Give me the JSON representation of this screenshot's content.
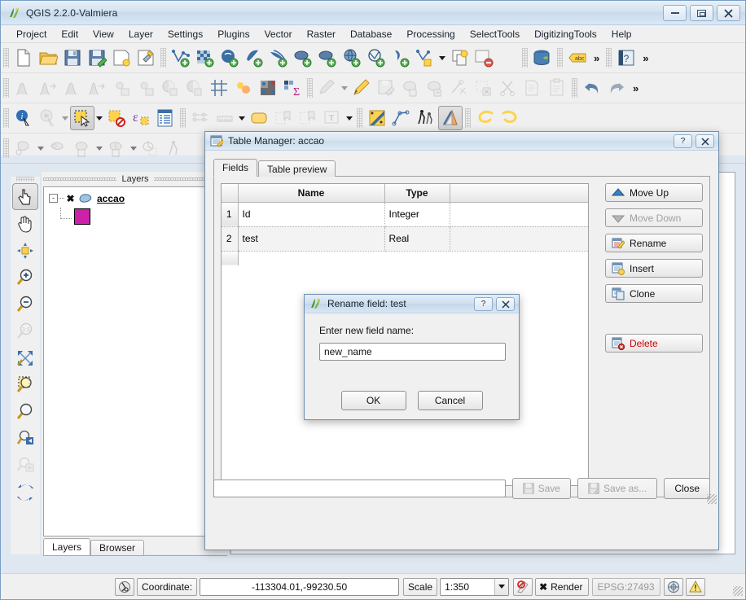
{
  "window": {
    "title": "QGIS 2.2.0-Valmiera",
    "icon": "qgis-logo-icon",
    "minimize": "minimize-icon",
    "maximize": "maximize-icon",
    "close": "close-icon"
  },
  "menu": {
    "items": [
      "Project",
      "Edit",
      "View",
      "Layer",
      "Settings",
      "Plugins",
      "Vector",
      "Raster",
      "Database",
      "Processing",
      "SelectTools",
      "DigitizingTools",
      "Help"
    ]
  },
  "toolbars": {
    "row1": [
      "new-project-icon",
      "open-project-icon",
      "save-project-icon",
      "save-project-as-icon",
      "new-print-composer-icon",
      "composer-manager-icon",
      "add-vector-layer-icon",
      "add-raster-layer-icon",
      "add-postgis-layer-icon",
      "add-spatialite-layer-icon",
      "add-mssql-layer-icon",
      "add-oracle-layer-icon",
      "add-wms-layer-icon",
      "add-wcs-layer-icon",
      "add-wfs-layer-icon",
      "add-delimited-text-layer-icon",
      "new-shapefile-layer-icon",
      "new-memory-layer-icon",
      "remove-layer-icon",
      "db-manager-icon",
      "abc-label-icon",
      "help-icon"
    ],
    "row2": [
      "manage-layers-icon",
      "manage-layers-2-icon",
      "hist-icon",
      "hist-2-icon",
      "brightness-up-icon",
      "brightness-down-icon",
      "contrast-up-icon",
      "contrast-down-icon",
      "grid-icon",
      "lights-icon",
      "raster-calc-icon",
      "statistics-icon",
      "toggle-editing-icon",
      "pencil-edit-icon",
      "save-layer-edits-icon",
      "add-feature-icon",
      "move-feature-icon",
      "node-tool-icon",
      "delete-selected-icon",
      "cut-features-icon",
      "copy-features-icon",
      "paste-features-icon",
      "undo-icon",
      "redo-icon"
    ],
    "row3": [
      "identify-features-icon",
      "run-feature-action-icon",
      "select-features-icon",
      "deselect-features-icon",
      "select-by-expression-icon",
      "open-attribute-table-icon",
      "measure-line-icon",
      "measure-area-icon",
      "map-tips-icon",
      "new-bookmark-icon",
      "show-bookmarks-icon",
      "text-annotation-icon",
      "style-manager-icon",
      "simplify-feature-icon",
      "offset-curve-icon",
      "measure-angle-icon",
      "lasso-left-icon",
      "lasso-right-icon"
    ],
    "row4": [
      "rotate-feature-icon",
      "split-feature-icon",
      "merge-features-icon",
      "merge-attributes-icon",
      "rotate-point-symbols-icon",
      "person-icon"
    ],
    "overflow_label": "»"
  },
  "left_toolbar": {
    "buttons": [
      {
        "name": "touch-zoom-pan-icon",
        "checked": true
      },
      {
        "name": "pan-map-icon",
        "checked": false
      },
      {
        "name": "pan-to-selection-icon",
        "checked": false
      },
      {
        "name": "zoom-in-icon",
        "checked": false
      },
      {
        "name": "zoom-out-icon",
        "checked": false
      },
      {
        "name": "zoom-native-icon",
        "checked": false
      },
      {
        "name": "zoom-full-icon",
        "checked": false
      },
      {
        "name": "zoom-to-selection-icon",
        "checked": false
      },
      {
        "name": "zoom-to-layer-icon",
        "checked": false
      },
      {
        "name": "zoom-last-icon",
        "checked": false
      },
      {
        "name": "zoom-next-icon",
        "checked": false
      },
      {
        "name": "refresh-icon",
        "checked": false
      }
    ]
  },
  "layers_panel": {
    "title": "Layers",
    "layer": {
      "name": "accao",
      "checked": true,
      "expander": "-",
      "symbol_color": "#cc22aa",
      "layer_icon": "polygon-layer-icon"
    },
    "tabs": [
      {
        "label": "Layers",
        "active": true
      },
      {
        "label": "Browser",
        "active": false
      }
    ]
  },
  "table_manager": {
    "title": "Table Manager: accao",
    "title_icon": "table-manager-icon",
    "help_button": "?",
    "close_button": "✕",
    "tabs": [
      {
        "label": "Fields",
        "active": true
      },
      {
        "label": "Table preview",
        "active": false
      }
    ],
    "table": {
      "headers": [
        "",
        "Name",
        "Type",
        ""
      ],
      "rows": [
        {
          "num": "1",
          "name": "Id",
          "type": "Integer"
        },
        {
          "num": "2",
          "name": "test",
          "type": "Real"
        }
      ]
    },
    "side_buttons": [
      {
        "label": "Move Up",
        "icon": "move-up-icon",
        "disabled": false,
        "danger": false
      },
      {
        "label": "Move Down",
        "icon": "move-down-icon",
        "disabled": true,
        "danger": false
      },
      {
        "label": "Rename",
        "icon": "rename-icon",
        "disabled": false,
        "danger": false
      },
      {
        "label": "Insert",
        "icon": "insert-icon",
        "disabled": false,
        "danger": false
      },
      {
        "label": "Clone",
        "icon": "clone-icon",
        "disabled": false,
        "danger": false
      },
      {
        "label": "Delete",
        "icon": "delete-icon",
        "disabled": false,
        "danger": true
      }
    ],
    "footer": {
      "path_value": "",
      "path_placeholder": "",
      "save_label": "Save",
      "save_icon": "save-icon",
      "save_as_label": "Save as...",
      "save_as_icon": "save-as-icon",
      "close_label": "Close"
    }
  },
  "rename_dialog": {
    "title": "Rename field: test",
    "title_icon": "qgis-logo-icon",
    "help_button": "?",
    "close_button": "✕",
    "label": "Enter new field name:",
    "input_value": "new_name",
    "input_placeholder": "",
    "ok_label": "OK",
    "cancel_label": "Cancel"
  },
  "statusbar": {
    "toggle_icon": "toggle-extents-icon",
    "coordinate_label": "Coordinate:",
    "coordinate_value": "-113304.01,-99230.50",
    "scale_label": "Scale",
    "scale_value": "1:350",
    "stop_render_icon": "stop-render-icon",
    "render_label": "Render",
    "render_checked": true,
    "epsg_label": "EPSG:27493",
    "crs_icon": "crs-icon",
    "messages_icon": "warning-icon"
  },
  "colors": {
    "accent": "#3a6ea5",
    "layer_symbol": "#cc22aa",
    "danger": "#d40000",
    "titlebar": "#cbdceb",
    "panel_bg": "#f0f0f0"
  }
}
